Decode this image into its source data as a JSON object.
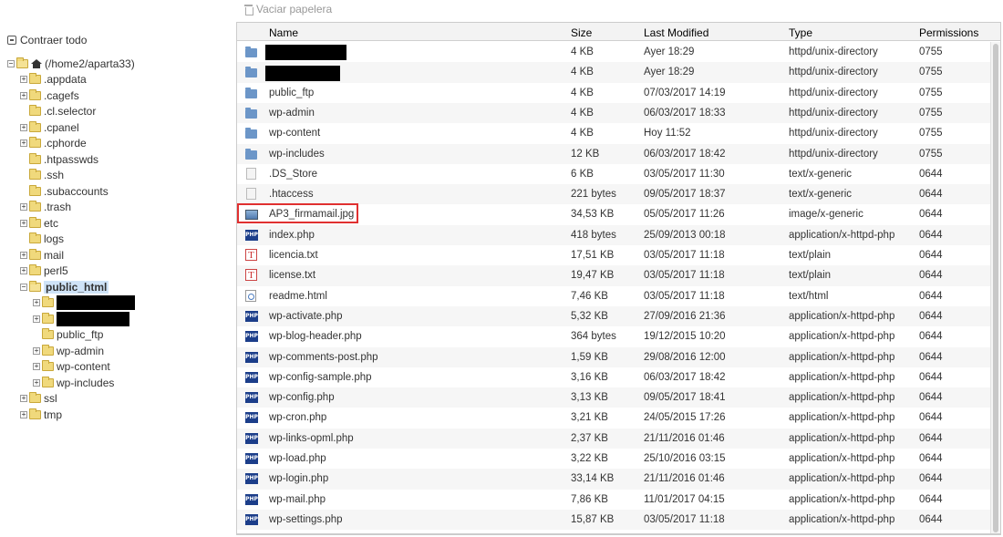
{
  "toolbar": {
    "empty_trash_label": "Vaciar papelera"
  },
  "tree": {
    "collapse_all_label": "Contraer todo",
    "root_label": "(/home2/aparta33)",
    "items": [
      {
        "label": ".appdata",
        "expandable": true,
        "level": 1
      },
      {
        "label": ".cagefs",
        "expandable": true,
        "level": 1
      },
      {
        "label": ".cl.selector",
        "expandable": false,
        "level": 1
      },
      {
        "label": ".cpanel",
        "expandable": true,
        "level": 1
      },
      {
        "label": ".cphorde",
        "expandable": true,
        "level": 1
      },
      {
        "label": ".htpasswds",
        "expandable": false,
        "level": 1
      },
      {
        "label": ".ssh",
        "expandable": false,
        "level": 1
      },
      {
        "label": ".subaccounts",
        "expandable": false,
        "level": 1
      },
      {
        "label": ".trash",
        "expandable": true,
        "level": 1
      },
      {
        "label": "etc",
        "expandable": true,
        "level": 1
      },
      {
        "label": "logs",
        "expandable": false,
        "level": 1
      },
      {
        "label": "mail",
        "expandable": true,
        "level": 1
      },
      {
        "label": "perl5",
        "expandable": true,
        "level": 1
      },
      {
        "label": "public_html",
        "expandable": true,
        "level": 1,
        "open": true,
        "selected": true
      },
      {
        "label": "",
        "expandable": true,
        "level": 2,
        "redacted": true
      },
      {
        "label": "",
        "expandable": true,
        "level": 2,
        "redacted": true
      },
      {
        "label": "public_ftp",
        "expandable": false,
        "level": 2
      },
      {
        "label": "wp-admin",
        "expandable": true,
        "level": 2
      },
      {
        "label": "wp-content",
        "expandable": true,
        "level": 2
      },
      {
        "label": "wp-includes",
        "expandable": true,
        "level": 2
      },
      {
        "label": "ssl",
        "expandable": true,
        "level": 1
      },
      {
        "label": "tmp",
        "expandable": true,
        "level": 1
      }
    ]
  },
  "table": {
    "headers": {
      "name": "Name",
      "size": "Size",
      "modified": "Last Modified",
      "type": "Type",
      "permissions": "Permissions"
    },
    "rows": [
      {
        "icon": "dir",
        "name": "",
        "redacted": true,
        "size": "4 KB",
        "modified": "Ayer 18:29",
        "type": "httpd/unix-directory",
        "perm": "0755"
      },
      {
        "icon": "dir",
        "name": "",
        "redacted": true,
        "size": "4 KB",
        "modified": "Ayer 18:29",
        "type": "httpd/unix-directory",
        "perm": "0755"
      },
      {
        "icon": "dir",
        "name": "public_ftp",
        "size": "4 KB",
        "modified": "07/03/2017 14:19",
        "type": "httpd/unix-directory",
        "perm": "0755"
      },
      {
        "icon": "dir",
        "name": "wp-admin",
        "size": "4 KB",
        "modified": "06/03/2017 18:33",
        "type": "httpd/unix-directory",
        "perm": "0755"
      },
      {
        "icon": "dir",
        "name": "wp-content",
        "size": "4 KB",
        "modified": "Hoy 11:52",
        "type": "httpd/unix-directory",
        "perm": "0755"
      },
      {
        "icon": "dir",
        "name": "wp-includes",
        "size": "12 KB",
        "modified": "06/03/2017 18:42",
        "type": "httpd/unix-directory",
        "perm": "0755"
      },
      {
        "icon": "generic",
        "name": ".DS_Store",
        "size": "6 KB",
        "modified": "03/05/2017 11:30",
        "type": "text/x-generic",
        "perm": "0644"
      },
      {
        "icon": "generic",
        "name": ".htaccess",
        "size": "221 bytes",
        "modified": "09/05/2017 18:37",
        "type": "text/x-generic",
        "perm": "0644"
      },
      {
        "icon": "image",
        "name": "AP3_firmamail.jpg",
        "highlighted": true,
        "size": "34,53 KB",
        "modified": "05/05/2017 11:26",
        "type": "image/x-generic",
        "perm": "0644"
      },
      {
        "icon": "php",
        "name": "index.php",
        "size": "418 bytes",
        "modified": "25/09/2013 00:18",
        "type": "application/x-httpd-php",
        "perm": "0644"
      },
      {
        "icon": "text",
        "name": "licencia.txt",
        "size": "17,51 KB",
        "modified": "03/05/2017 11:18",
        "type": "text/plain",
        "perm": "0644"
      },
      {
        "icon": "text",
        "name": "license.txt",
        "size": "19,47 KB",
        "modified": "03/05/2017 11:18",
        "type": "text/plain",
        "perm": "0644"
      },
      {
        "icon": "html",
        "name": "readme.html",
        "size": "7,46 KB",
        "modified": "03/05/2017 11:18",
        "type": "text/html",
        "perm": "0644"
      },
      {
        "icon": "php",
        "name": "wp-activate.php",
        "size": "5,32 KB",
        "modified": "27/09/2016 21:36",
        "type": "application/x-httpd-php",
        "perm": "0644"
      },
      {
        "icon": "php",
        "name": "wp-blog-header.php",
        "size": "364 bytes",
        "modified": "19/12/2015 10:20",
        "type": "application/x-httpd-php",
        "perm": "0644"
      },
      {
        "icon": "php",
        "name": "wp-comments-post.php",
        "size": "1,59 KB",
        "modified": "29/08/2016 12:00",
        "type": "application/x-httpd-php",
        "perm": "0644"
      },
      {
        "icon": "php",
        "name": "wp-config-sample.php",
        "size": "3,16 KB",
        "modified": "06/03/2017 18:42",
        "type": "application/x-httpd-php",
        "perm": "0644"
      },
      {
        "icon": "php",
        "name": "wp-config.php",
        "size": "3,13 KB",
        "modified": "09/05/2017 18:41",
        "type": "application/x-httpd-php",
        "perm": "0644"
      },
      {
        "icon": "php",
        "name": "wp-cron.php",
        "size": "3,21 KB",
        "modified": "24/05/2015 17:26",
        "type": "application/x-httpd-php",
        "perm": "0644"
      },
      {
        "icon": "php",
        "name": "wp-links-opml.php",
        "size": "2,37 KB",
        "modified": "21/11/2016 01:46",
        "type": "application/x-httpd-php",
        "perm": "0644"
      },
      {
        "icon": "php",
        "name": "wp-load.php",
        "size": "3,22 KB",
        "modified": "25/10/2016 03:15",
        "type": "application/x-httpd-php",
        "perm": "0644"
      },
      {
        "icon": "php",
        "name": "wp-login.php",
        "size": "33,14 KB",
        "modified": "21/11/2016 01:46",
        "type": "application/x-httpd-php",
        "perm": "0644"
      },
      {
        "icon": "php",
        "name": "wp-mail.php",
        "size": "7,86 KB",
        "modified": "11/01/2017 04:15",
        "type": "application/x-httpd-php",
        "perm": "0644"
      },
      {
        "icon": "php",
        "name": "wp-settings.php",
        "size": "15,87 KB",
        "modified": "03/05/2017 11:18",
        "type": "application/x-httpd-php",
        "perm": "0644"
      }
    ]
  },
  "icons": {
    "php_icon_text": "PHP",
    "text_icon_text": "T"
  },
  "colors": {
    "highlight_border": "#e03030",
    "folder_blue": "#6c96c8",
    "selected_bg": "#cfe3f7"
  }
}
